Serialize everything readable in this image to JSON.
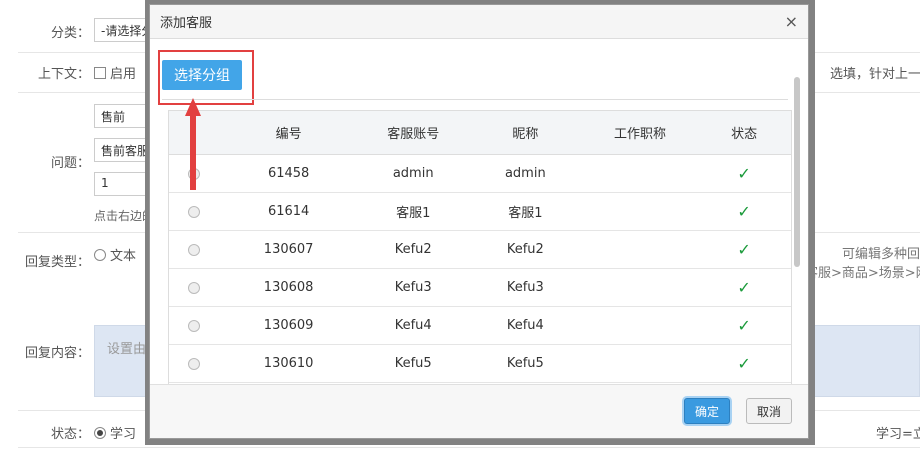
{
  "form": {
    "category_label": "分类：",
    "category_value": "-请选择分",
    "context_label": "上下文：",
    "context_option": "启用",
    "context_hint": "选填，针对上一",
    "question_label": "问题：",
    "question_sel1": "售前",
    "question_sel2": "售前客服",
    "question_num": "1",
    "question_hint": "点击右边的",
    "reply_type_label": "回复类型：",
    "reply_type_option": "文本",
    "reply_type_hint1": "可编辑多种回",
    "reply_type_hint2": "客服>商品>场景>网",
    "reply_content_label": "回复内容：",
    "reply_content_placeholder": "设置由指",
    "status_label": "状态：",
    "status_option": "学习",
    "status_hint": "学习=立"
  },
  "modal": {
    "title": "添加客服",
    "close": "×",
    "choose_group": "选择分组",
    "headers": [
      "编号",
      "客服账号",
      "昵称",
      "工作职称",
      "状态"
    ],
    "rows": [
      {
        "id": "61458",
        "account": "admin",
        "nick": "admin",
        "title": "",
        "status": "✓"
      },
      {
        "id": "61614",
        "account": "客服1",
        "nick": "客服1",
        "title": "",
        "status": "✓"
      },
      {
        "id": "130607",
        "account": "Kefu2",
        "nick": "Kefu2",
        "title": "",
        "status": "✓"
      },
      {
        "id": "130608",
        "account": "Kefu3",
        "nick": "Kefu3",
        "title": "",
        "status": "✓"
      },
      {
        "id": "130609",
        "account": "Kefu4",
        "nick": "Kefu4",
        "title": "",
        "status": "✓"
      },
      {
        "id": "130610",
        "account": "Kefu5",
        "nick": "Kefu5",
        "title": "",
        "status": "✓"
      }
    ],
    "ok": "确定",
    "cancel": "取消"
  },
  "colors": {
    "accent": "#42a5e8",
    "highlight": "#e24040",
    "check": "#1a9a3a"
  }
}
